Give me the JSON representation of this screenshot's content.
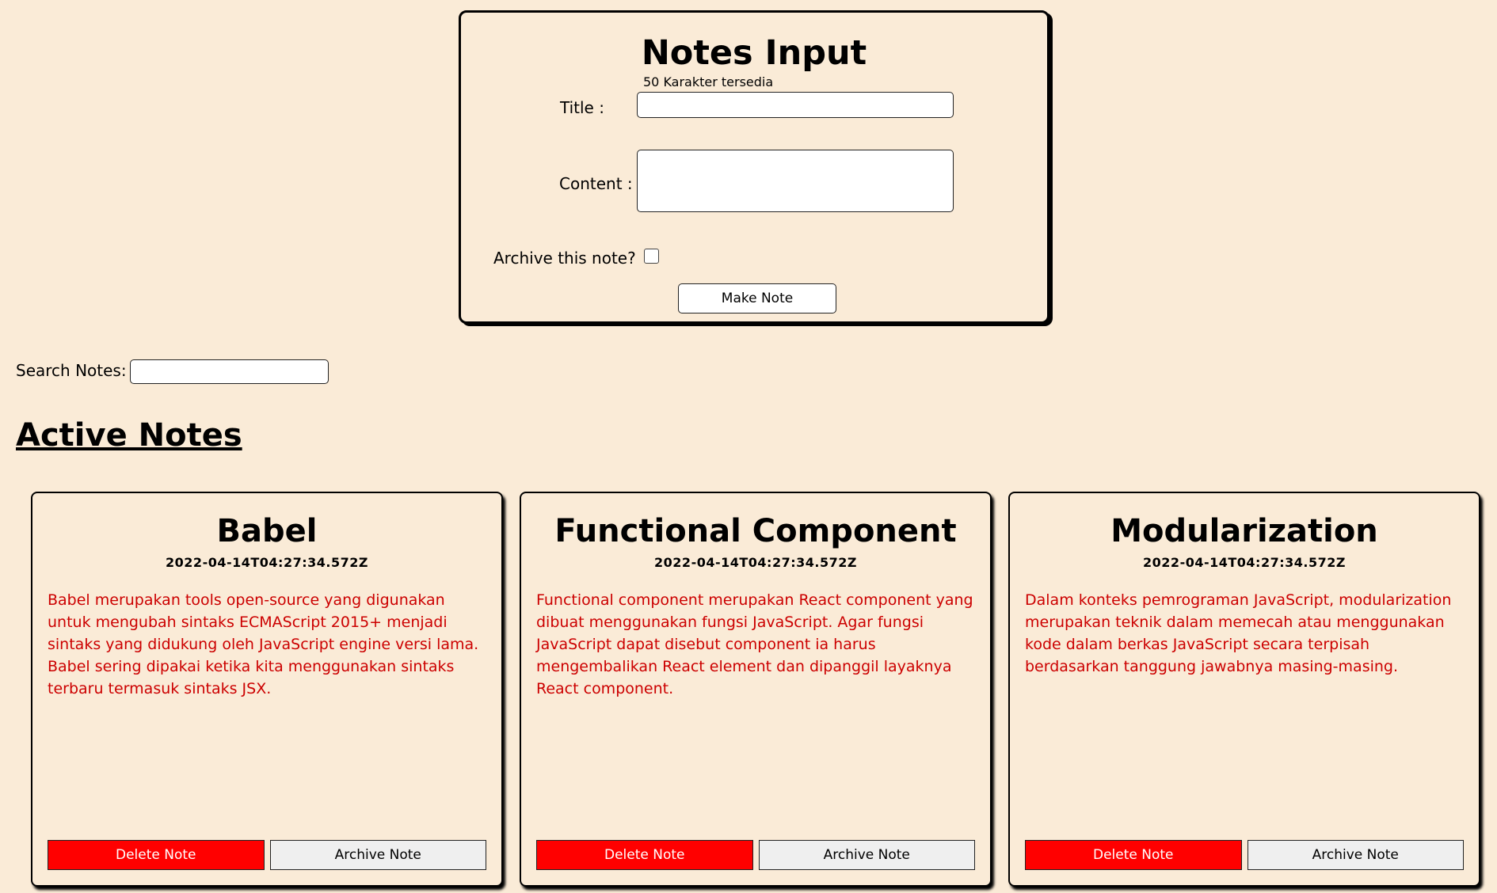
{
  "input_form": {
    "heading": "Notes Input",
    "char_counter": "50 Karakter tersedia",
    "title_label": "Title :",
    "title_value": "",
    "content_label": "Content :",
    "content_value": "",
    "archive_label": "Archive this note?",
    "archive_checked": false,
    "submit_label": "Make Note"
  },
  "search": {
    "label": "Search Notes:",
    "value": ""
  },
  "active_section": {
    "heading": "Active Notes"
  },
  "notes": [
    {
      "title": "Babel",
      "date": "2022-04-14T04:27:34.572Z",
      "body": "Babel merupakan tools open-source yang digunakan untuk mengubah sintaks ECMAScript 2015+ menjadi sintaks yang didukung oleh JavaScript engine versi lama. Babel sering dipakai ketika kita menggunakan sintaks terbaru termasuk sintaks JSX.",
      "delete_label": "Delete Note",
      "archive_label": "Archive Note"
    },
    {
      "title": "Functional Component",
      "date": "2022-04-14T04:27:34.572Z",
      "body": "Functional component merupakan React component yang dibuat menggunakan fungsi JavaScript. Agar fungsi JavaScript dapat disebut component ia harus mengembalikan React element dan dipanggil layaknya React component.",
      "delete_label": "Delete Note",
      "archive_label": "Archive Note"
    },
    {
      "title": "Modularization",
      "date": "2022-04-14T04:27:34.572Z",
      "body": "Dalam konteks pemrograman JavaScript, modularization merupakan teknik dalam memecah atau menggunakan kode dalam berkas JavaScript secara terpisah berdasarkan tanggung jawabnya masing-masing.",
      "delete_label": "Delete Note",
      "archive_label": "Archive Note"
    }
  ],
  "colors": {
    "background": "#faebd7",
    "note_body_text": "#cc0000",
    "delete_button": "#ff0000",
    "archive_button": "#efefef"
  }
}
